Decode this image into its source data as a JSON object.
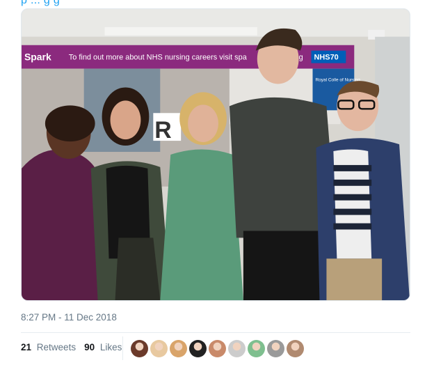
{
  "photo": {
    "banner_brand": "Spark",
    "banner_text": "To find out more about NHS nursing careers visit spa",
    "banner_text_end": "g",
    "banner_badge": "NHS70",
    "poster_text": "Royal Colle of Nursing",
    "poster_letter": "R"
  },
  "tweet": {
    "header_fragment": "p    ...   g   g",
    "timestamp": "8:27 PM - 11 Dec 2018",
    "retweets_count": "21",
    "retweets_label": "Retweets",
    "likes_count": "90",
    "likes_label": "Likes"
  },
  "colors": {
    "link_blue": "#1da1f2",
    "meta_gray": "#657786",
    "banner_purple": "#8b2a7e",
    "nhs_blue": "#005eb8"
  },
  "liker_avatars": [
    {
      "name": "avatar-1",
      "color": "#6b3a2a"
    },
    {
      "name": "avatar-2",
      "color": "#e8c9a0"
    },
    {
      "name": "avatar-3",
      "color": "#d9a46a"
    },
    {
      "name": "avatar-4",
      "color": "#222222"
    },
    {
      "name": "avatar-5",
      "color": "#c98a6a"
    },
    {
      "name": "avatar-6",
      "color": "#cccccc"
    },
    {
      "name": "avatar-7",
      "color": "#7fbf8f"
    },
    {
      "name": "avatar-8",
      "color": "#9a9a9a"
    },
    {
      "name": "avatar-9",
      "color": "#b08a70"
    }
  ]
}
